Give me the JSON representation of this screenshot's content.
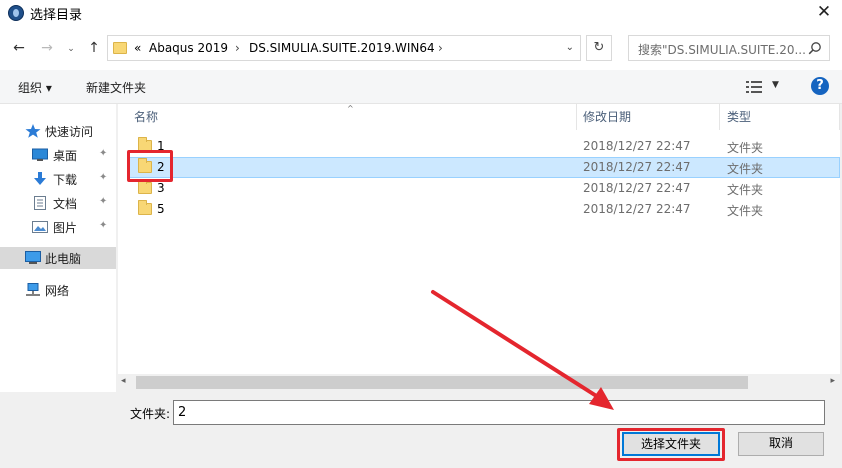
{
  "window": {
    "title": "选择目录",
    "accent": "#0078d7",
    "annotation_color": "#e4262e"
  },
  "nav": {
    "back_glyph": "←",
    "forward_glyph": "→",
    "history_glyph": "⌄",
    "up_glyph": "↑",
    "breadcrumb_prefix": "«",
    "breadcrumb": [
      "Abaqus 2019",
      "DS.SIMULIA.SUITE.2019.WIN64"
    ],
    "breadcrumb_sep": "›",
    "dropdown_glyph": "⌄",
    "refresh_glyph": "↻",
    "search_placeholder": "搜索\"DS.SIMULIA.SUITE.20..."
  },
  "toolbar": {
    "organize_label": "组织 ▾",
    "new_folder_label": "新建文件夹",
    "view_dd_glyph": "▼",
    "help_label": "?"
  },
  "sidebar": {
    "pin_glyph": "✦",
    "items": [
      {
        "label": "快速访问",
        "icon": "star-icon"
      },
      {
        "label": "桌面",
        "icon": "desktop-icon",
        "pinned": true
      },
      {
        "label": "下载",
        "icon": "download-icon",
        "pinned": true
      },
      {
        "label": "文档",
        "icon": "documents-icon",
        "pinned": true
      },
      {
        "label": "图片",
        "icon": "pictures-icon",
        "pinned": true
      },
      {
        "label": "此电脑",
        "icon": "computer-icon",
        "selected": true
      },
      {
        "label": "网络",
        "icon": "network-icon"
      }
    ]
  },
  "filelist": {
    "sort_glyph": "^",
    "columns": {
      "name": "名称",
      "date": "修改日期",
      "type": "类型"
    },
    "rows": [
      {
        "name": "1",
        "date": "2018/12/27 22:47",
        "type": "文件夹"
      },
      {
        "name": "2",
        "date": "2018/12/27 22:47",
        "type": "文件夹",
        "selected": true
      },
      {
        "name": "3",
        "date": "2018/12/27 22:47",
        "type": "文件夹"
      },
      {
        "name": "5",
        "date": "2018/12/27 22:47",
        "type": "文件夹"
      }
    ]
  },
  "scrollbar": {
    "left_glyph": "◂",
    "right_glyph": "▸"
  },
  "footer": {
    "folder_label": "文件夹:",
    "folder_value": "2",
    "select_button": "选择文件夹",
    "cancel_button": "取消"
  },
  "titlebar": {
    "close_glyph": "✕"
  }
}
